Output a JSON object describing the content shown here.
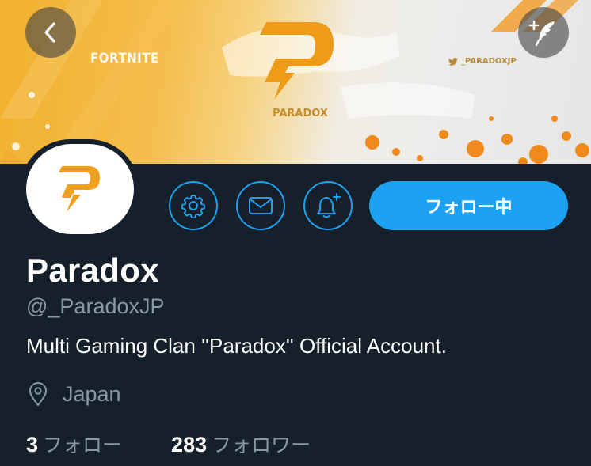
{
  "banner": {
    "fortnite_text": "FORTNITE",
    "paradox_text": "PARADOX",
    "handle_text": "_PARADOXJP"
  },
  "nav": {
    "back_icon": "chevron-left-icon",
    "compose_icon": "compose-feather-icon"
  },
  "actions": {
    "settings_icon": "gear-icon",
    "message_icon": "mail-icon",
    "notify_icon": "bell-plus-icon",
    "follow_label": "フォロー中"
  },
  "profile": {
    "name": "Paradox",
    "handle": "@_ParadoxJP",
    "bio": "Multi Gaming Clan ''Paradox'' Official Account.",
    "location": "Japan"
  },
  "stats": {
    "following_count": "3",
    "following_label": "フォロー",
    "followers_count": "283",
    "followers_label": "フォロワー"
  },
  "colors": {
    "background": "#15202b",
    "accent": "#1da1f2",
    "secondary_text": "#8899a6",
    "brand_orange": "#f0a020"
  }
}
